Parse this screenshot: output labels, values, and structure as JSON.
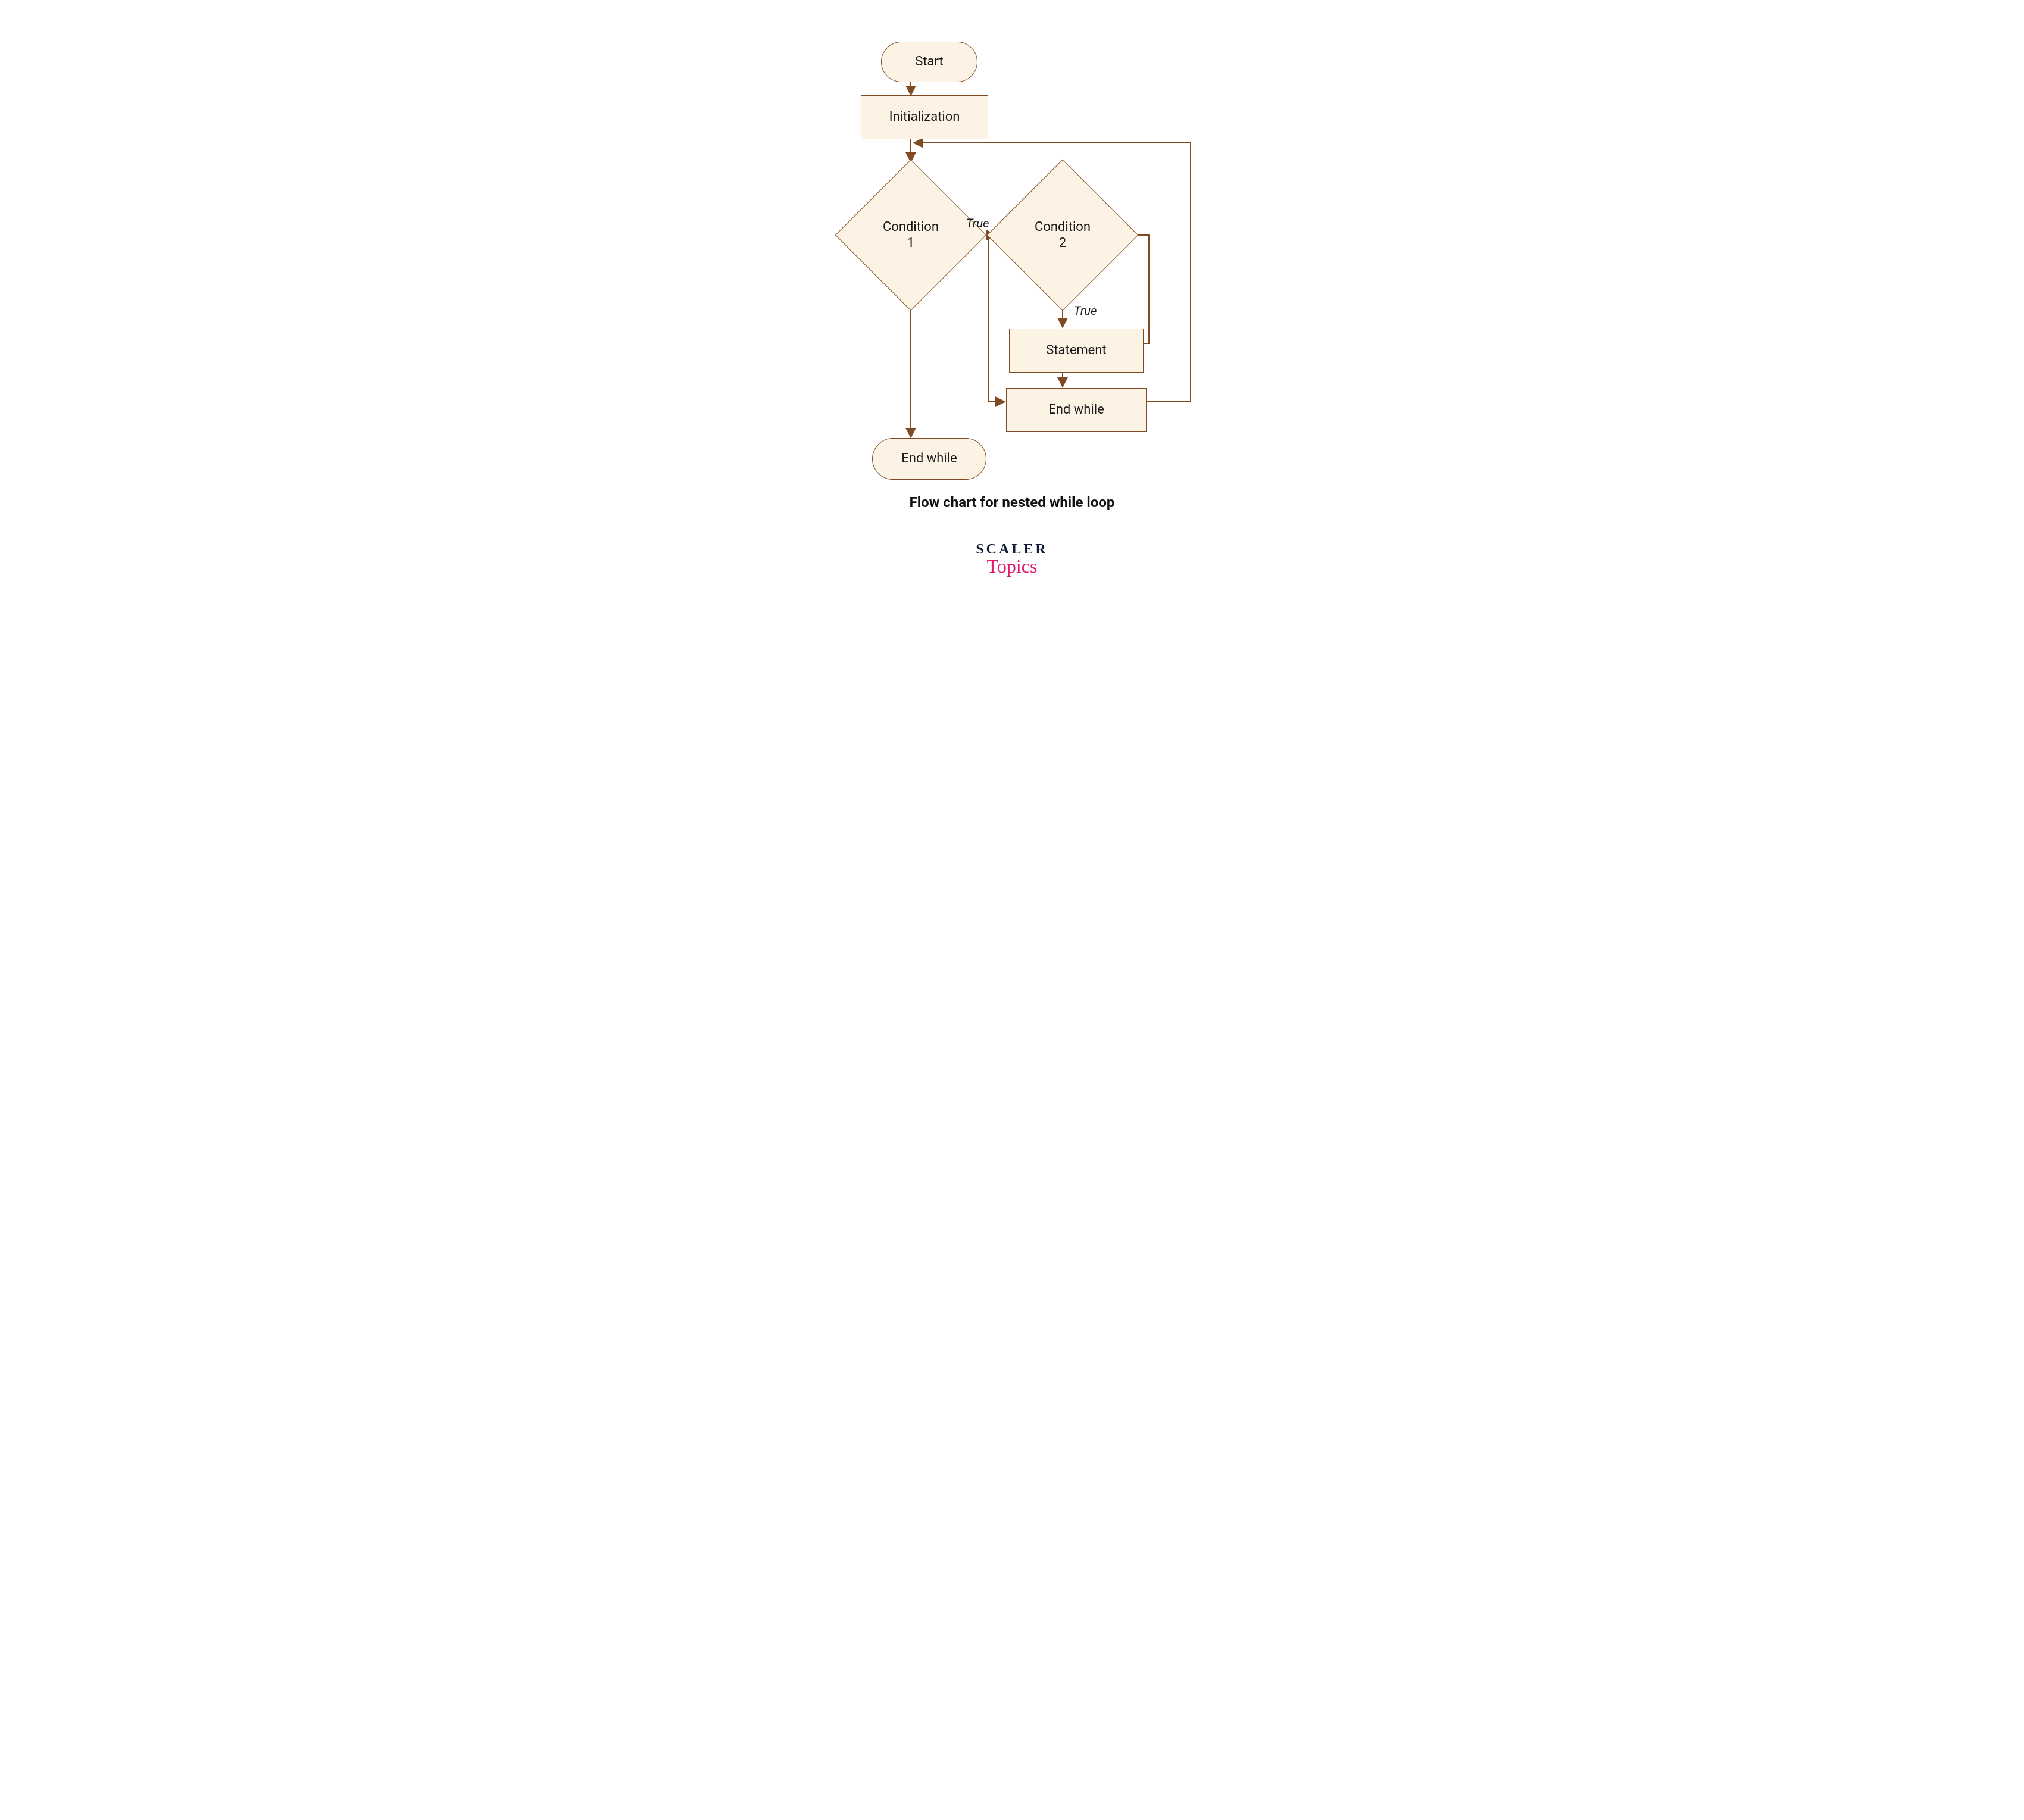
{
  "nodes": {
    "start": "Start",
    "init": "Initialization",
    "cond1": "Condition\n1",
    "cond2": "Condition\n2",
    "stmt": "Statement",
    "endInner": "End while",
    "endOuter": "End while"
  },
  "edges": {
    "trueC1": "True",
    "trueC2": "True"
  },
  "caption": "Flow chart for nested while loop",
  "brand": {
    "line1": "SCALER",
    "line2": "Topics"
  },
  "colors": {
    "stroke": "#7E4B24",
    "fill": "#FDF3E4",
    "accent": "#e3176f"
  }
}
